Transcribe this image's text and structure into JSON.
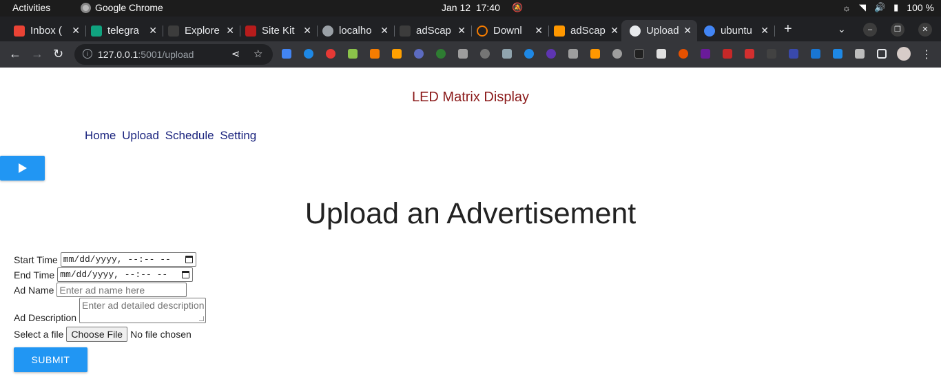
{
  "os": {
    "activities": "Activities",
    "app_name": "Google Chrome",
    "date": "Jan 12",
    "time": "17:40",
    "battery": "100 %"
  },
  "tabs": [
    {
      "title": "Inbox (",
      "color": "#ea4335",
      "active": false
    },
    {
      "title": "telegra",
      "color": "#10a37f",
      "active": false
    },
    {
      "title": "Explore",
      "color": "#5f6368",
      "active": false
    },
    {
      "title": "Site Kit",
      "color": "#b71c1c",
      "active": false
    },
    {
      "title": "localho",
      "color": "#9aa0a6",
      "active": false
    },
    {
      "title": "adScap",
      "color": "#5f6368",
      "active": false
    },
    {
      "title": "Downl",
      "color": "#f57c00",
      "active": false
    },
    {
      "title": "adScap",
      "color": "#ff9800",
      "active": false
    },
    {
      "title": "Upload",
      "color": "#e8eaed",
      "active": true
    },
    {
      "title": "ubuntu",
      "color": "#4285f4",
      "active": false
    }
  ],
  "address": {
    "url_main": "127.0.0.1",
    "url_rest": ":5001/upload"
  },
  "page": {
    "brand": "LED Matrix Display",
    "nav": [
      "Home",
      "Upload",
      "Schedule",
      "Setting"
    ],
    "heading": "Upload an Advertisement",
    "form": {
      "start_label": "Start Time",
      "start_value": "mm/dd/yyyy, --:-- --",
      "end_label": "End Time",
      "end_value": "mm/dd/yyyy, --:-- --",
      "name_label": "Ad Name",
      "name_placeholder": "Enter ad name here",
      "desc_label": "Ad Description",
      "desc_placeholder": "Enter ad detailed description",
      "file_label": "Select a file",
      "file_button": "Choose File",
      "file_status": "No file chosen",
      "submit": "SUBMIT"
    }
  },
  "colors": {
    "brand": "#8b1a1a",
    "nav_link": "#1a237e",
    "primary_button": "#2196f3"
  }
}
